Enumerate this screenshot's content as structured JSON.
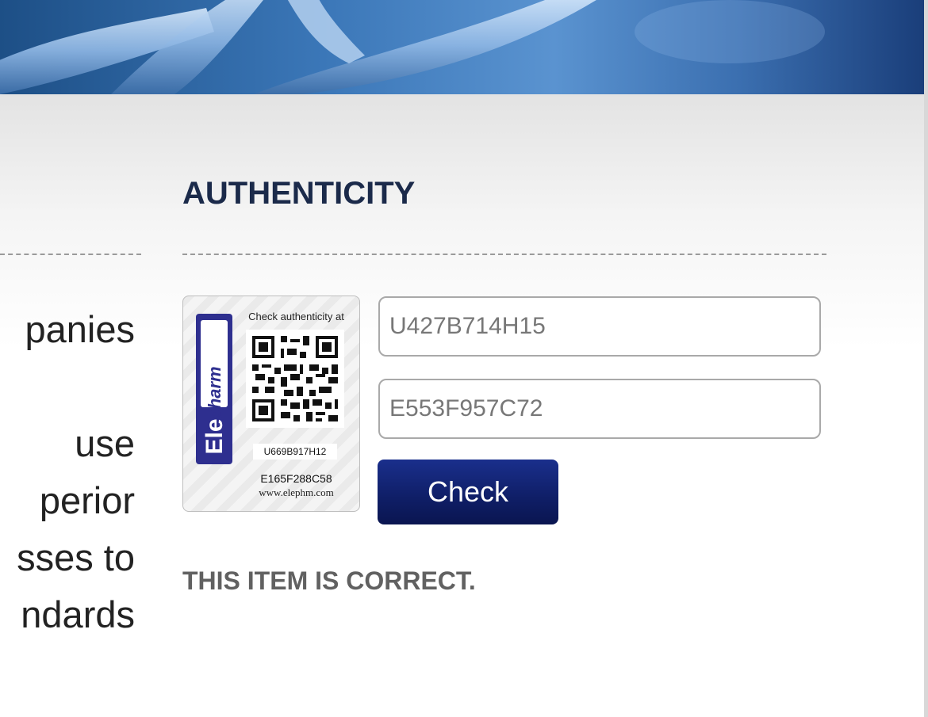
{
  "authenticity": {
    "title": "AUTHENTICITY",
    "code1_value": "U427B714H15",
    "code2_value": "E553F957C72",
    "check_button": "Check",
    "result": "THIS ITEM IS CORRECT."
  },
  "label": {
    "check_text": "Check authenticity at",
    "code1": "U669B917H12",
    "code2": "E165F288C58",
    "url": "www.elephm.com",
    "logo_text": "Elepharm"
  },
  "left_column": {
    "lines": [
      "panies",
      "",
      "use",
      "perior",
      "sses to",
      "ndards"
    ]
  },
  "colors": {
    "title": "#1b2a4a",
    "button": "#0f1e66",
    "result": "#616161"
  }
}
